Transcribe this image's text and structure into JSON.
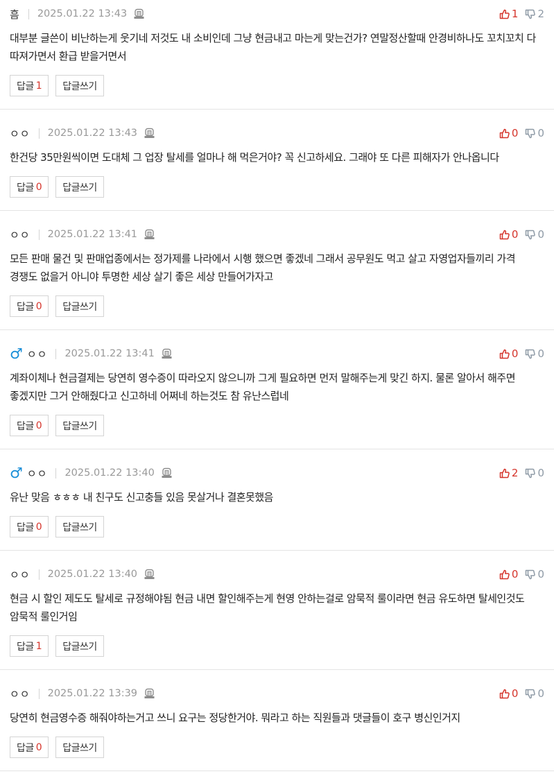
{
  "colors": {
    "accent": "#d5342b",
    "male": "#1a8fd8",
    "muted": "#999999",
    "down": "#8e9aa6"
  },
  "labels": {
    "reply": "답글",
    "write_reply": "답글쓰기"
  },
  "comments": [
    {
      "gender": "",
      "nick": "흠",
      "date": "2025.01.22 13:43",
      "up": "1",
      "down": "2",
      "text": "대부분 글쓴이 비난하는게 웃기네 저것도 내 소비인데 그냥 현금내고 마는게 맞는건가? 연말정산할때 안경비하나도 꼬치꼬치 다 따져가면서 환급 받을거면서",
      "replies": "1"
    },
    {
      "gender": "",
      "nick": "ㅇㅇ",
      "date": "2025.01.22 13:43",
      "up": "0",
      "down": "0",
      "text": "한건당 35만원씩이면 도대체 그 업장 탈세를 얼마나 해 먹은거야? 꼭 신고하세요. 그래야 또 다른 피해자가 안나옵니다",
      "replies": "0"
    },
    {
      "gender": "",
      "nick": "ㅇㅇ",
      "date": "2025.01.22 13:41",
      "up": "0",
      "down": "0",
      "text": "모든 판매 물건 및 판매업종에서는 정가제를 나라에서 시행 했으면 좋겠네 그래서 공무원도 먹고 살고 자영업자들끼리 가격 경쟁도 없을거 아니야 투명한 세상 살기 좋은 세상 만들어가자고",
      "replies": "0"
    },
    {
      "gender": "♂",
      "nick": "ㅇㅇ",
      "date": "2025.01.22 13:41",
      "up": "0",
      "down": "0",
      "text": "계좌이체나 현금결제는 당연히 영수증이 따라오지 않으니까 그게 필요하면 먼저 말해주는게 맞긴 하지. 물론 알아서 해주면 좋겠지만 그거 안해줬다고 신고하네 어쩌네 하는것도 참 유난스럽네",
      "replies": "0"
    },
    {
      "gender": "♂",
      "nick": "ㅇㅇ",
      "date": "2025.01.22 13:40",
      "up": "2",
      "down": "0",
      "text": "유난 맞음 ㅎㅎㅎ 내 친구도 신고충들 있음 못살거나 결혼못했음",
      "replies": "0"
    },
    {
      "gender": "",
      "nick": "ㅇㅇ",
      "date": "2025.01.22 13:40",
      "up": "0",
      "down": "0",
      "text": "현금 시 할인 제도도 탈세로 규정해야됨 현금 내면 할인해주는게 현영 안하는걸로 암묵적 룰이라면 현금 유도하면 탈세인것도 암묵적 룰인거임",
      "replies": "1"
    },
    {
      "gender": "",
      "nick": "ㅇㅇ",
      "date": "2025.01.22 13:39",
      "up": "0",
      "down": "0",
      "text": "당연히 현금영수증 해줘야하는거고 쓰니 요구는 정당한거야. 뭐라고 하는 직원들과 댓글들이 호구 병신인거지",
      "replies": "0"
    }
  ]
}
